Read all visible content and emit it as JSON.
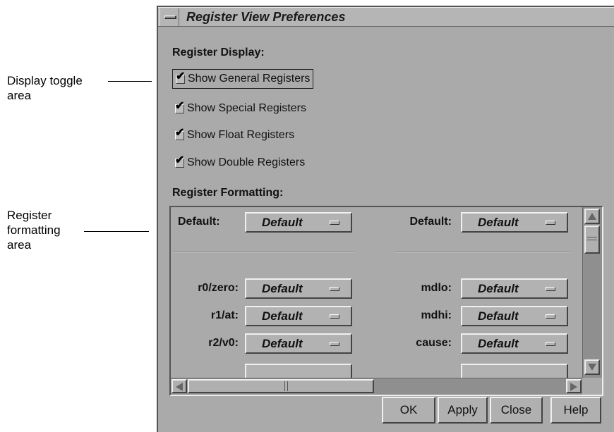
{
  "callouts": {
    "display_toggle_line1": "Display toggle",
    "display_toggle_line2": "area",
    "register_formatting_line1": "Register",
    "register_formatting_line2": "formatting",
    "register_formatting_line3": "area"
  },
  "window": {
    "title": "Register View Preferences"
  },
  "display": {
    "heading": "Register Display:",
    "checkboxes": [
      {
        "label": "Show General Registers",
        "checked": true
      },
      {
        "label": "Show Special Registers",
        "checked": true
      },
      {
        "label": "Show Float Registers",
        "checked": true
      },
      {
        "label": "Show Double Registers",
        "checked": true
      }
    ],
    "check_glyph": "✔"
  },
  "formatting": {
    "heading": "Register Formatting:",
    "left_column": [
      {
        "label": "Default:",
        "value": "Default"
      },
      {
        "label": "r0/zero:",
        "value": "Default"
      },
      {
        "label": "r1/at:",
        "value": "Default"
      },
      {
        "label": "r2/v0:",
        "value": "Default"
      }
    ],
    "right_column": [
      {
        "label": "Default:",
        "value": "Default"
      },
      {
        "label": "mdlo:",
        "value": "Default"
      },
      {
        "label": "mdhi:",
        "value": "Default"
      },
      {
        "label": "cause:",
        "value": "Default"
      }
    ]
  },
  "buttons": {
    "ok": "OK",
    "apply": "Apply",
    "close": "Close",
    "help": "Help"
  }
}
